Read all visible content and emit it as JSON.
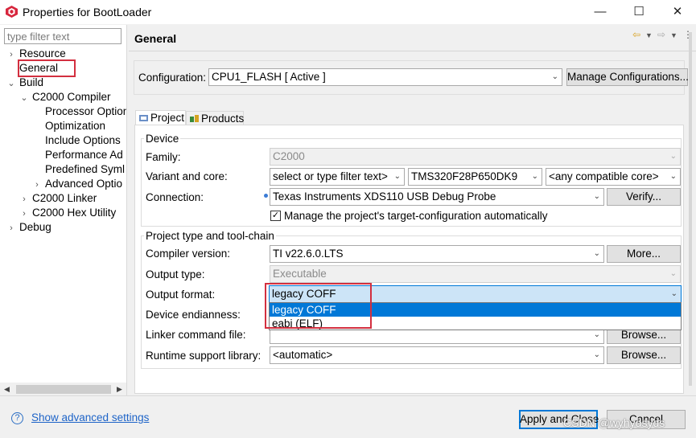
{
  "window": {
    "title": "Properties for BootLoader",
    "minimize": "—",
    "maximize": "☐",
    "close": "✕",
    "icon": "app-logo-icon"
  },
  "left_panel": {
    "filter_placeholder": "type filter text",
    "tree": [
      {
        "label": "Resource",
        "indent": 0,
        "twisty": "›",
        "selected": false,
        "highlighted": false
      },
      {
        "label": "General",
        "indent": 0,
        "twisty": "",
        "selected": true,
        "highlighted": true
      },
      {
        "label": "Build",
        "indent": 0,
        "twisty": "⌄",
        "selected": false,
        "highlighted": false
      },
      {
        "label": "C2000 Compiler",
        "indent": 1,
        "twisty": "⌄",
        "selected": false,
        "highlighted": false
      },
      {
        "label": "Processor Option",
        "indent": 2,
        "twisty": "",
        "selected": false,
        "highlighted": false
      },
      {
        "label": "Optimization",
        "indent": 2,
        "twisty": "",
        "selected": false,
        "highlighted": false
      },
      {
        "label": "Include Options",
        "indent": 2,
        "twisty": "",
        "selected": false,
        "highlighted": false
      },
      {
        "label": "Performance Ad",
        "indent": 2,
        "twisty": "",
        "selected": false,
        "highlighted": false
      },
      {
        "label": "Predefined Syml",
        "indent": 2,
        "twisty": "",
        "selected": false,
        "highlighted": false
      },
      {
        "label": "Advanced Optio",
        "indent": 2,
        "twisty": "›",
        "selected": false,
        "highlighted": false
      },
      {
        "label": "C2000 Linker",
        "indent": 1,
        "twisty": "›",
        "selected": false,
        "highlighted": false
      },
      {
        "label": "C2000 Hex Utility",
        "indent": 1,
        "twisty": "›",
        "selected": false,
        "highlighted": false
      },
      {
        "label": "Debug",
        "indent": 0,
        "twisty": "›",
        "selected": false,
        "highlighted": false
      }
    ],
    "scroll_left": "◀",
    "scroll_right": "▶"
  },
  "header": {
    "title": "General",
    "nav_icons": [
      "back-arrow-icon",
      "dropdown-icon",
      "forward-arrow-icon",
      "dropdown-icon",
      "menu-icon"
    ]
  },
  "configuration": {
    "label": "Configuration:",
    "value": "CPU1_FLASH  [ Active ]",
    "manage_button": "Manage Configurations..."
  },
  "tabs": [
    {
      "label": "Project",
      "active": true,
      "icon": "project-tab-icon"
    },
    {
      "label": "Products",
      "active": false,
      "icon": "products-tab-icon"
    }
  ],
  "device": {
    "group_title": "Device",
    "family_label": "Family:",
    "family_value": "C2000",
    "variant_label": "Variant and core:",
    "variant_filter": "select or type filter text>",
    "variant_value": "TMS320F28P650DK9",
    "core_value": "<any compatible core>",
    "connection_label": "Connection:",
    "connection_value": "Texas Instruments XDS110 USB Debug Probe",
    "verify_button": "Verify...",
    "manage_checkbox_label": "Manage the project's target-configuration automatically",
    "manage_checked": true
  },
  "toolchain": {
    "group_title": "Project type and tool-chain",
    "compiler_label": "Compiler version:",
    "compiler_value": "TI v22.6.0.LTS",
    "more_button": "More...",
    "output_type_label": "Output type:",
    "output_type_value": "Executable",
    "output_format_label": "Output format:",
    "output_format_value": "legacy COFF",
    "output_format_options": [
      "legacy COFF",
      "eabi (ELF)"
    ],
    "output_format_selected_index": 0,
    "endianness_label": "Device endianness:",
    "linker_label": "Linker command file:",
    "browse_button": "Browse...",
    "runtime_label": "Runtime support library:",
    "runtime_value": "<automatic>"
  },
  "footer": {
    "help_icon": "help-icon",
    "advanced_link": "Show advanced settings",
    "apply_close_button": "Apply and Close",
    "cancel_button": "Cancel",
    "watermark": "CSDN @wyhydsyds"
  },
  "colors": {
    "highlight_red": "#d32f3f",
    "selection_blue": "#0078d7",
    "link_blue": "#1e64c8"
  }
}
